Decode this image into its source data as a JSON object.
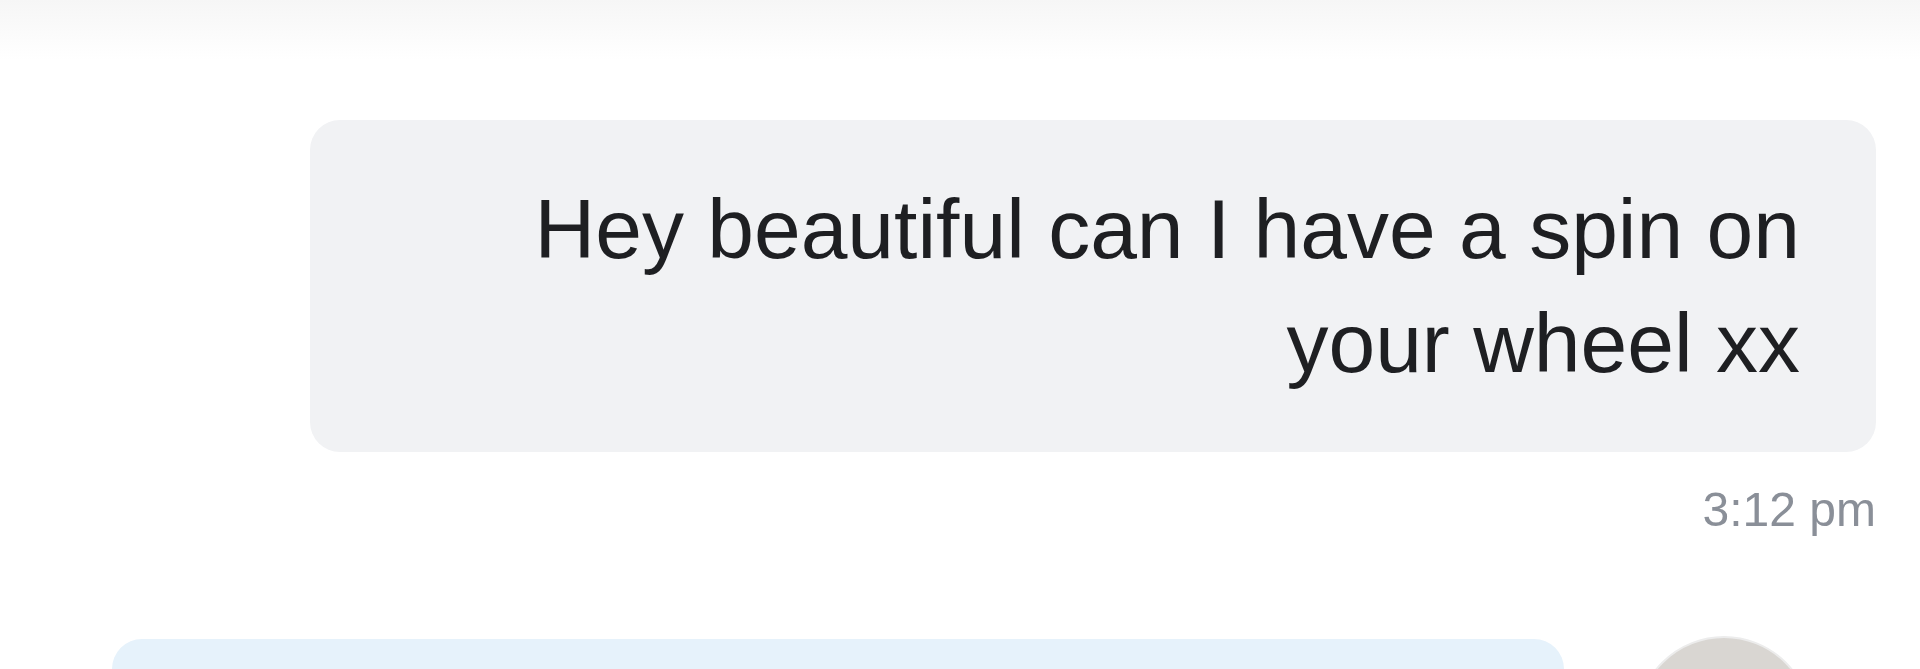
{
  "messages": [
    {
      "kind": "received",
      "text": "Hey beautiful can I have a spin on your wheel xx",
      "time": "3:12 pm"
    },
    {
      "kind": "sent_with_avatar"
    }
  ]
}
